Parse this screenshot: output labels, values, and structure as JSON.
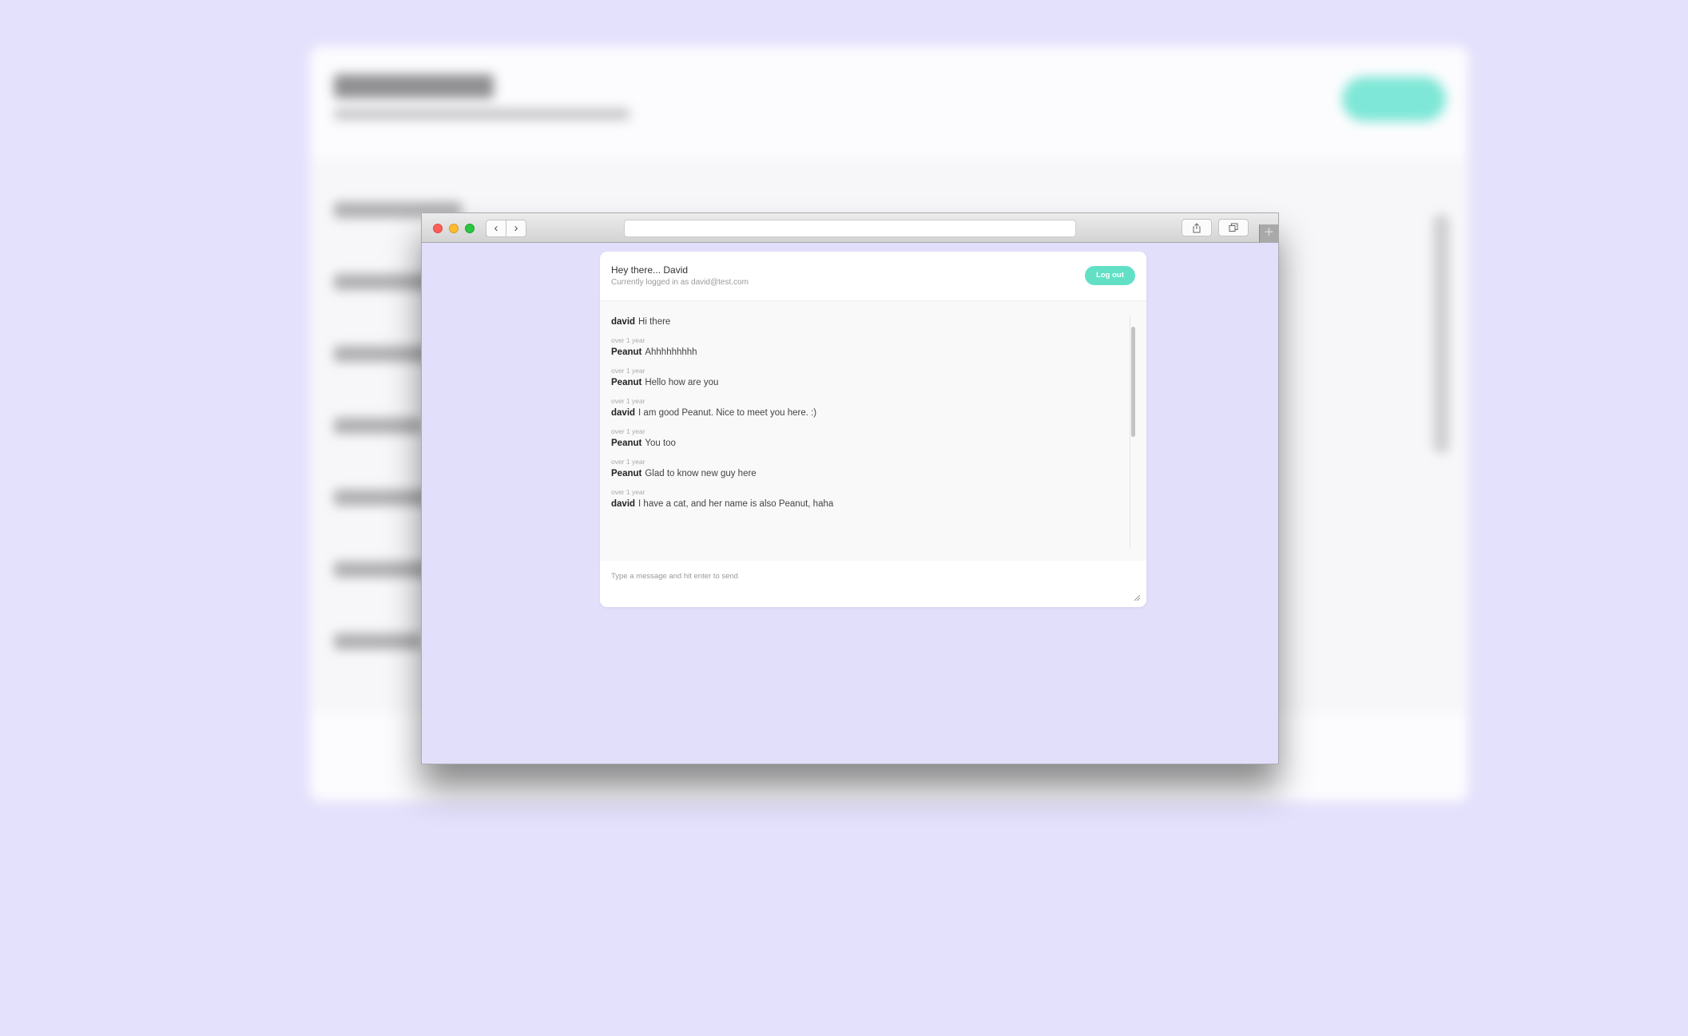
{
  "chat": {
    "greeting": "Hey there... David",
    "logged_in": "Currently logged in as david@test.com",
    "logout_label": "Log out",
    "composer_placeholder": "Type a message and hit enter to send",
    "messages": [
      {
        "time": "",
        "user": "david",
        "text": "Hi there"
      },
      {
        "time": "over 1 year",
        "user": "Peanut",
        "text": "Ahhhhhhhhh"
      },
      {
        "time": "over 1 year",
        "user": "Peanut",
        "text": "Hello how are you"
      },
      {
        "time": "over 1 year",
        "user": "david",
        "text": "I am good Peanut. Nice to meet you here. :)"
      },
      {
        "time": "over 1 year",
        "user": "Peanut",
        "text": "You too"
      },
      {
        "time": "over 1 year",
        "user": "Peanut",
        "text": "Glad to know new guy here"
      },
      {
        "time": "over 1 year",
        "user": "david",
        "text": "I have a cat, and her name is also Peanut, haha"
      }
    ]
  },
  "browser": {
    "icons": [
      "back-arrow-icon",
      "forward-arrow-icon",
      "share-icon",
      "tabs-icon",
      "plus-icon"
    ]
  },
  "colors": {
    "background": "#e4e1fc",
    "accent": "#62e0c6"
  }
}
